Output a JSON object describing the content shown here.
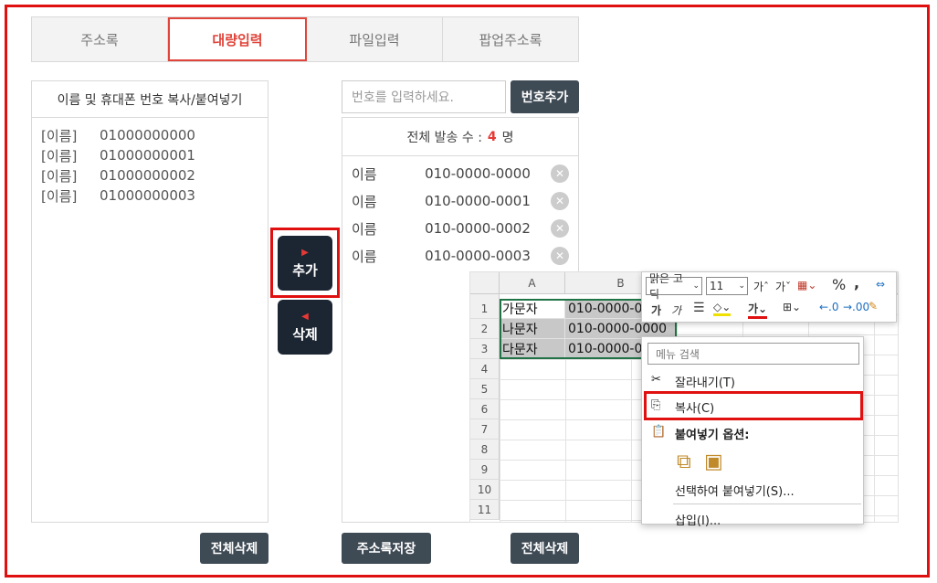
{
  "tabs": [
    "주소록",
    "대량입력",
    "파일입력",
    "팝업주소록"
  ],
  "left": {
    "heading": "이름 및 휴대폰 번호 복사/붙여넣기",
    "rows": [
      {
        "name": "[이름]",
        "phone": "01000000000"
      },
      {
        "name": "[이름]",
        "phone": "01000000001"
      },
      {
        "name": "[이름]",
        "phone": "01000000002"
      },
      {
        "name": "[이름]",
        "phone": "01000000003"
      }
    ],
    "clear_label": "전체삭제"
  },
  "move": {
    "add_arrow": "▶",
    "add_label": "추가",
    "del_arrow": "◀",
    "del_label": "삭제"
  },
  "right": {
    "input_placeholder": "번호를 입력하세요.",
    "add_number_label": "번호추가",
    "count_prefix": "전체 발송 수 :",
    "count": "4",
    "count_suffix": "명",
    "recipients": [
      {
        "name": "이름",
        "phone": "010-0000-0000"
      },
      {
        "name": "이름",
        "phone": "010-0000-0001"
      },
      {
        "name": "이름",
        "phone": "010-0000-0002"
      },
      {
        "name": "이름",
        "phone": "010-0000-0003"
      }
    ],
    "save_label": "주소록저장",
    "clear_label": "전체삭제"
  },
  "excel": {
    "col_a": "A",
    "col_b": "B",
    "rows": [
      "1",
      "2",
      "3",
      "4",
      "5",
      "6",
      "7",
      "8",
      "9",
      "10",
      "11"
    ],
    "cells": [
      {
        "a": "가문자",
        "b": "010-0000-0000"
      },
      {
        "a": "나문자",
        "b": "010-0000-0000"
      },
      {
        "a": "다문자",
        "b": "010-0000-0000"
      }
    ],
    "font_name": "맑은 고딕",
    "font_size": "11"
  },
  "context_menu": {
    "search_placeholder": "메뉴 검색",
    "cut": "잘라내기(T)",
    "copy": "복사(C)",
    "paste_options": "붙여넣기 옵션:",
    "paste_special": "선택하여 붙여넣기(S)...",
    "insert": "삽입(I)..."
  },
  "colors": {
    "accent": "#e0443a",
    "dark_button": "#1c2633",
    "frame": "#e01010"
  }
}
